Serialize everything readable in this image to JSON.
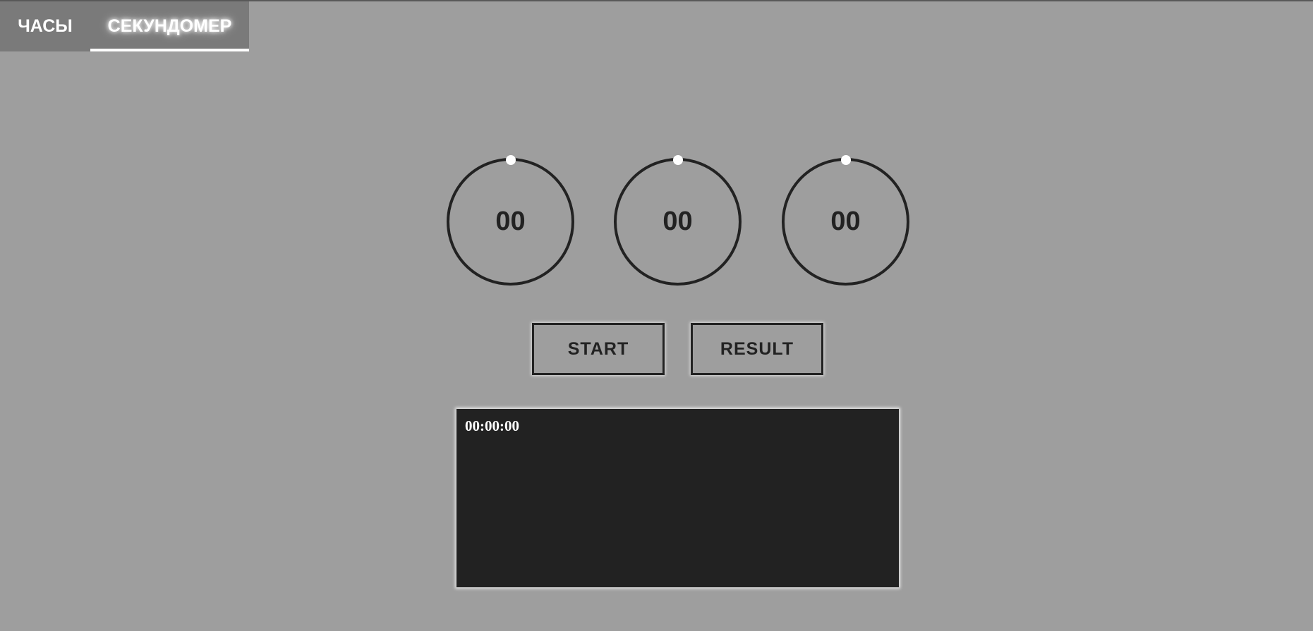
{
  "tabs": {
    "clock_label": "ЧАСЫ",
    "stopwatch_label": "СЕКУНДОМЕР",
    "active": "stopwatch"
  },
  "dials": [
    {
      "value": "00"
    },
    {
      "value": "00"
    },
    {
      "value": "00"
    }
  ],
  "buttons": {
    "start_label": "START",
    "result_label": "RESULT"
  },
  "results": {
    "lines": [
      "00:00:00"
    ]
  },
  "colors": {
    "background": "#9e9e9e",
    "tab_bar": "#7a7a7a",
    "dark": "#222222",
    "accent": "#ffffff"
  }
}
